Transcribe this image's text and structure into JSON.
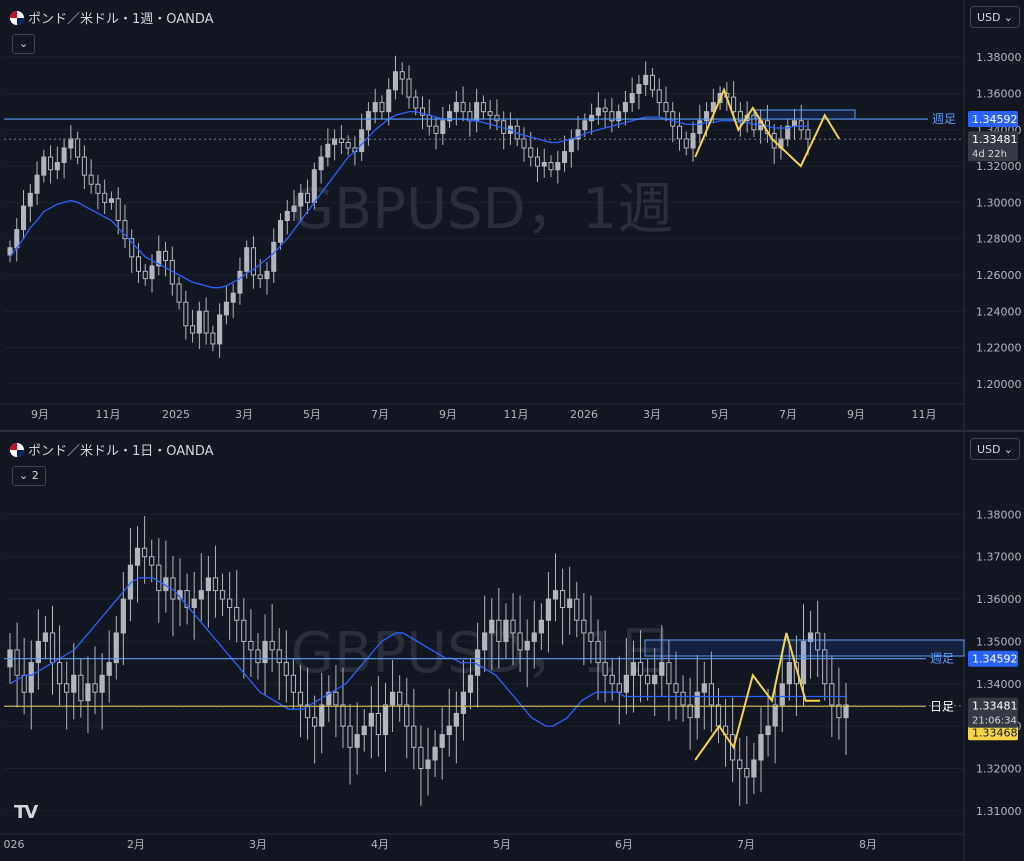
{
  "colors": {
    "bg": "#131722",
    "grid": "#1e222d",
    "candle": "#b2b5be",
    "ma": "#2962ff",
    "hline": "#5b9cf6",
    "yellow": "#f5d547",
    "axis_text": "#b2b5be"
  },
  "top": {
    "title": "ポンド／米ドル・1週・OANDA",
    "currency": "USD",
    "watermark": "GBPUSD，1週",
    "collapse_icon": "chevron-down-icon",
    "hline_label": "週足",
    "price_label": "1.34592",
    "current_price": "1.33481",
    "countdown": "4d 22h"
  },
  "bottom": {
    "title": "ポンド／米ドル・1日・OANDA",
    "currency": "USD",
    "watermark": "GBPUSD，1日",
    "collapse_label": "2",
    "hline_label": "週足",
    "price_label": "1.34592",
    "hline2_label": "日足",
    "current_price": "1.33481",
    "countdown": "21:06:34",
    "yellow_price": "1.33468",
    "logo": "TV"
  },
  "chart_data": [
    {
      "type": "candlestick",
      "title": "ポンド／米ドル・1週・OANDA",
      "ylim": [
        1.19,
        1.395
      ],
      "y_ticks": [
        "1.38000",
        "1.36000",
        "1.34000",
        "1.32000",
        "1.30000",
        "1.28000",
        "1.26000",
        "1.24000",
        "1.22000",
        "1.20000"
      ],
      "y_tick_values": [
        1.38,
        1.36,
        1.34,
        1.32,
        1.3,
        1.28,
        1.26,
        1.24,
        1.22,
        1.2
      ],
      "x_ticks": [
        "9月",
        "11月",
        "2025",
        "3月",
        "5月",
        "7月",
        "9月",
        "11月",
        "2026",
        "3月",
        "5月",
        "7月",
        "9月",
        "11月"
      ],
      "close": [
        1.275,
        1.285,
        1.298,
        1.305,
        1.315,
        1.325,
        1.318,
        1.322,
        1.33,
        1.335,
        1.325,
        1.315,
        1.31,
        1.305,
        1.3,
        1.302,
        1.29,
        1.28,
        1.27,
        1.262,
        1.258,
        1.265,
        1.273,
        1.268,
        1.255,
        1.245,
        1.232,
        1.228,
        1.24,
        1.228,
        1.222,
        1.238,
        1.245,
        1.25,
        1.262,
        1.275,
        1.26,
        1.258,
        1.262,
        1.278,
        1.29,
        1.295,
        1.298,
        1.305,
        1.3,
        1.318,
        1.325,
        1.332,
        1.335,
        1.333,
        1.33,
        1.328,
        1.34,
        1.35,
        1.355,
        1.35,
        1.362,
        1.372,
        1.368,
        1.358,
        1.352,
        1.348,
        1.342,
        1.338,
        1.345,
        1.35,
        1.355,
        1.35,
        1.345,
        1.355,
        1.35,
        1.348,
        1.345,
        1.338,
        1.342,
        1.335,
        1.33,
        1.325,
        1.32,
        1.322,
        1.318,
        1.322,
        1.328,
        1.335,
        1.34,
        1.345,
        1.348,
        1.352,
        1.35,
        1.345,
        1.35,
        1.355,
        1.36,
        1.365,
        1.37,
        1.362,
        1.355,
        1.35,
        1.342,
        1.335,
        1.33,
        1.338,
        1.345,
        1.35,
        1.355,
        1.36,
        1.358,
        1.35,
        1.345,
        1.348,
        1.34,
        1.345,
        1.338,
        1.33,
        1.335,
        1.342,
        1.345,
        1.34,
        1.335
      ],
      "ma": [
        1.27,
        1.275,
        1.28,
        1.286,
        1.29,
        1.295,
        1.297,
        1.299,
        1.3,
        1.301,
        1.3,
        1.298,
        1.296,
        1.294,
        1.292,
        1.29,
        1.286,
        1.282,
        1.278,
        1.274,
        1.27,
        1.268,
        1.266,
        1.264,
        1.262,
        1.26,
        1.258,
        1.256,
        1.255,
        1.254,
        1.253,
        1.253,
        1.254,
        1.256,
        1.258,
        1.261,
        1.263,
        1.266,
        1.269,
        1.272,
        1.276,
        1.28,
        1.285,
        1.29,
        1.295,
        1.3,
        1.305,
        1.31,
        1.315,
        1.32,
        1.325,
        1.328,
        1.332,
        1.336,
        1.34,
        1.343,
        1.346,
        1.348,
        1.349,
        1.35,
        1.35,
        1.349,
        1.348,
        1.347,
        1.346,
        1.346,
        1.346,
        1.346,
        1.345,
        1.345,
        1.344,
        1.343,
        1.342,
        1.341,
        1.34,
        1.338,
        1.337,
        1.336,
        1.335,
        1.334,
        1.333,
        1.333,
        1.334,
        1.335,
        1.336,
        1.338,
        1.339,
        1.34,
        1.341,
        1.342,
        1.343,
        1.344,
        1.345,
        1.346,
        1.347,
        1.347,
        1.347,
        1.346,
        1.345,
        1.344,
        1.343,
        1.343,
        1.343,
        1.344,
        1.344,
        1.345,
        1.345,
        1.345,
        1.344,
        1.344,
        1.343,
        1.343,
        1.342,
        1.341,
        1.341,
        1.341,
        1.342,
        1.342,
        1.342
      ],
      "hline": 1.34592,
      "current": 1.33481,
      "zigzag": [
        [
          0.72,
          1.325
        ],
        [
          0.75,
          1.362
        ],
        [
          0.765,
          1.34
        ],
        [
          0.78,
          1.352
        ],
        [
          0.8,
          1.335
        ],
        [
          0.83,
          1.32
        ],
        [
          0.855,
          1.348
        ],
        [
          0.87,
          1.335
        ]
      ]
    },
    {
      "type": "candlestick",
      "title": "ポンド／米ドル・1日・OANDA",
      "ylim": [
        1.305,
        1.39
      ],
      "y_ticks": [
        "1.38000",
        "1.37000",
        "1.36000",
        "1.35000",
        "1.34000",
        "1.33000",
        "1.32000",
        "1.31000"
      ],
      "y_tick_values": [
        1.38,
        1.37,
        1.36,
        1.35,
        1.34,
        1.33,
        1.32,
        1.31
      ],
      "x_ticks": [
        "026",
        "2月",
        "3月",
        "4月",
        "5月",
        "6月",
        "7月",
        "8月"
      ],
      "close": [
        1.348,
        1.342,
        1.338,
        1.345,
        1.35,
        1.352,
        1.345,
        1.34,
        1.338,
        1.342,
        1.336,
        1.34,
        1.338,
        1.342,
        1.345,
        1.352,
        1.36,
        1.368,
        1.372,
        1.37,
        1.368,
        1.362,
        1.365,
        1.36,
        1.362,
        1.358,
        1.36,
        1.362,
        1.365,
        1.362,
        1.36,
        1.358,
        1.355,
        1.35,
        1.348,
        1.345,
        1.35,
        1.348,
        1.345,
        1.342,
        1.338,
        1.335,
        1.332,
        1.33,
        1.335,
        1.338,
        1.335,
        1.33,
        1.325,
        1.328,
        1.33,
        1.333,
        1.328,
        1.335,
        1.338,
        1.335,
        1.33,
        1.325,
        1.32,
        1.322,
        1.325,
        1.328,
        1.33,
        1.333,
        1.338,
        1.342,
        1.348,
        1.352,
        1.355,
        1.35,
        1.355,
        1.352,
        1.348,
        1.35,
        1.352,
        1.355,
        1.36,
        1.362,
        1.358,
        1.36,
        1.355,
        1.352,
        1.35,
        1.345,
        1.342,
        1.34,
        1.338,
        1.342,
        1.345,
        1.342,
        1.34,
        1.342,
        1.345,
        1.34,
        1.338,
        1.335,
        1.332,
        1.338,
        1.34,
        1.335,
        1.33,
        1.328,
        1.322,
        1.32,
        1.318,
        1.322,
        1.328,
        1.33,
        1.335,
        1.34,
        1.345,
        1.34,
        1.35,
        1.352,
        1.348,
        1.34,
        1.335,
        1.332,
        1.335
      ],
      "ma": [
        1.34,
        1.341,
        1.342,
        1.342,
        1.343,
        1.344,
        1.345,
        1.346,
        1.347,
        1.348,
        1.35,
        1.352,
        1.354,
        1.356,
        1.358,
        1.36,
        1.362,
        1.364,
        1.365,
        1.365,
        1.365,
        1.364,
        1.363,
        1.362,
        1.36,
        1.358,
        1.356,
        1.354,
        1.352,
        1.35,
        1.348,
        1.346,
        1.344,
        1.342,
        1.34,
        1.338,
        1.337,
        1.336,
        1.335,
        1.334,
        1.334,
        1.334,
        1.335,
        1.336,
        1.337,
        1.338,
        1.339,
        1.34,
        1.342,
        1.344,
        1.346,
        1.348,
        1.35,
        1.351,
        1.352,
        1.352,
        1.351,
        1.35,
        1.349,
        1.348,
        1.347,
        1.346,
        1.346,
        1.345,
        1.345,
        1.345,
        1.344,
        1.343,
        1.342,
        1.34,
        1.338,
        1.336,
        1.334,
        1.332,
        1.331,
        1.33,
        1.33,
        1.331,
        1.332,
        1.334,
        1.336,
        1.337,
        1.338,
        1.338,
        1.338,
        1.338,
        1.337,
        1.337,
        1.337,
        1.337,
        1.337,
        1.337,
        1.337,
        1.337,
        1.337,
        1.337,
        1.337,
        1.337,
        1.337,
        1.337,
        1.337,
        1.337,
        1.337,
        1.337,
        1.337,
        1.337,
        1.337,
        1.337,
        1.337,
        1.337,
        1.337,
        1.337,
        1.337,
        1.337,
        1.337,
        1.337,
        1.337,
        1.337
      ],
      "hline": 1.34592,
      "hline2": 1.33468,
      "current": 1.33481,
      "zigzag": [
        [
          0.72,
          1.322
        ],
        [
          0.745,
          1.33
        ],
        [
          0.76,
          1.325
        ],
        [
          0.78,
          1.342
        ],
        [
          0.8,
          1.336
        ],
        [
          0.815,
          1.352
        ],
        [
          0.835,
          1.336
        ],
        [
          0.85,
          1.336
        ]
      ]
    }
  ]
}
